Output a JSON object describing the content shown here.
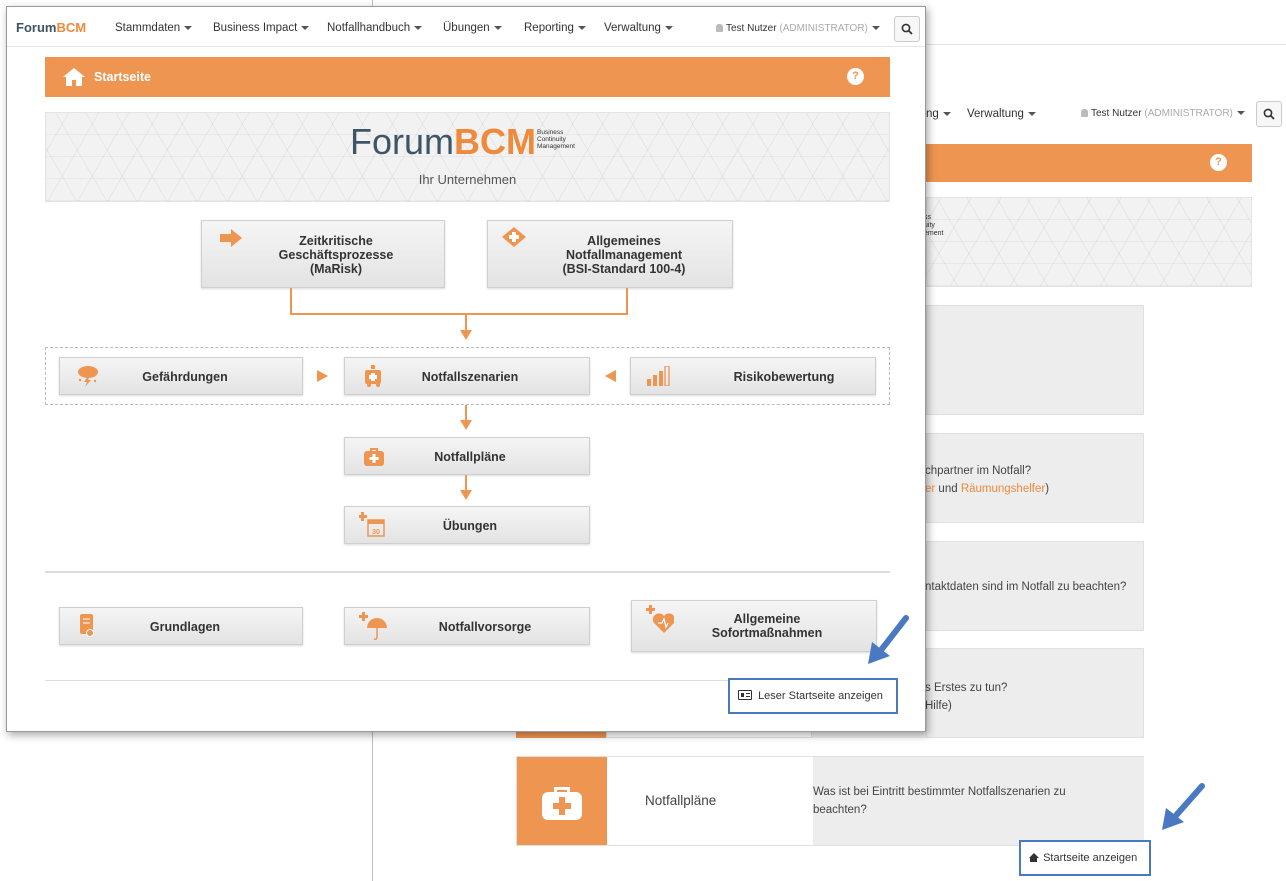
{
  "back_window": {
    "nav": {
      "partial_menu_label": "ng",
      "verwaltung_label": "Verwaltung",
      "user_name": "Test Nutzer",
      "user_role": "(ADMINISTRATOR)"
    },
    "help_label": "?",
    "logo_partial_lines": [
      "ss",
      "uity",
      "ement"
    ],
    "cards": [
      {
        "text_line1": "chpartner im Notfall?",
        "text_line2_part1": "er",
        "text_line2_mid": " und ",
        "text_line2_link": "Räumungshelfer",
        "text_line2_end": ")"
      },
      {
        "text": "ntaktdaten sind im Notfall zu beachten?"
      },
      {
        "text_line1": "s Erstes zu tun?",
        "text_line2": "Hilfe)"
      }
    ],
    "notfallplaene_card": {
      "title": "Notfallpläne",
      "description": "Was ist bei Eintritt bestimmter Notfallszenarien zu beachten?"
    },
    "startseite_button_label": "Startseite anzeigen"
  },
  "front_window": {
    "brand": {
      "part1": "Forum",
      "part2": "BCM"
    },
    "menu": [
      {
        "label": "Stammdaten"
      },
      {
        "label": "Business Impact"
      },
      {
        "label": "Notfallhandbuch"
      },
      {
        "label": "Übungen"
      },
      {
        "label": "Reporting"
      },
      {
        "label": "Verwaltung"
      }
    ],
    "user_name": "Test Nutzer",
    "user_role": "(ADMINISTRATOR)",
    "page_title": "Startseite",
    "help_label": "?",
    "logo": {
      "part1": "Forum",
      "part2": "BCM",
      "tag_lines": [
        "Business",
        "Continuity",
        "Management"
      ],
      "company": "Ihr Unternehmen"
    },
    "top_boxes": [
      {
        "lines": [
          "Zeitkritische",
          "Geschäftsprozesse",
          "(MaRisk)"
        ]
      },
      {
        "lines": [
          "Allgemeines",
          "Notfallmanagement",
          "(BSI-Standard 100-4)"
        ]
      }
    ],
    "middle_row": {
      "gefaehrdungen": "Gefährdungen",
      "notfallszenarien": "Notfallszenarien",
      "risikobewertung": "Risikobewertung"
    },
    "notfallplaene": "Notfallpläne",
    "uebungen": "Übungen",
    "calendar_num": "30",
    "bottom_row": {
      "grundlagen": "Grundlagen",
      "notfallvorsorge": "Notfallvorsorge",
      "sofort_line1": "Allgemeine",
      "sofort_line2": "Sofortmaßnahmen"
    },
    "leser_button_label": "Leser Startseite anzeigen"
  },
  "colors": {
    "accent_orange": "#ef9552",
    "brand_blue": "#3d5566",
    "highlight_blue": "#4a79c4"
  }
}
